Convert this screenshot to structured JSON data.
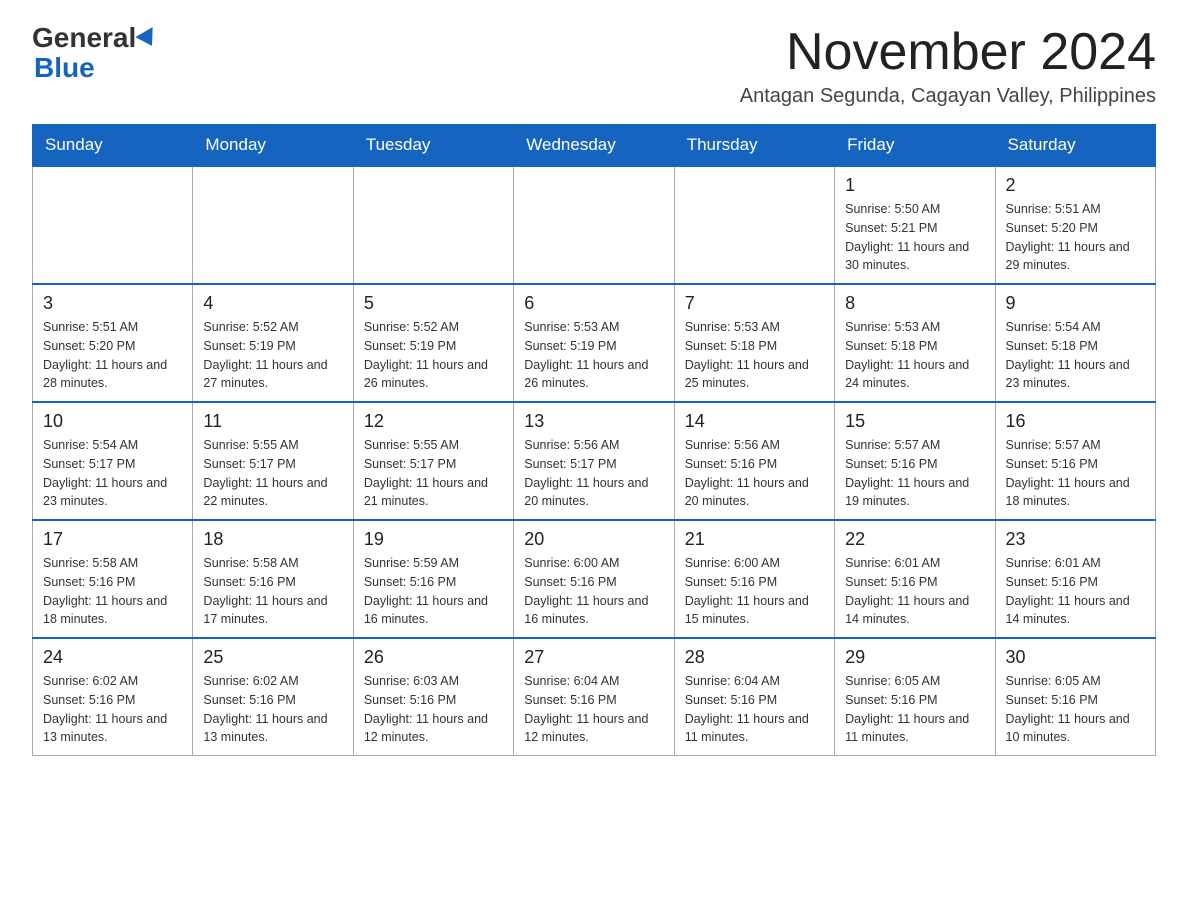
{
  "logo": {
    "general": "General",
    "blue": "Blue"
  },
  "title": "November 2024",
  "subtitle": "Antagan Segunda, Cagayan Valley, Philippines",
  "days_of_week": [
    "Sunday",
    "Monday",
    "Tuesday",
    "Wednesday",
    "Thursday",
    "Friday",
    "Saturday"
  ],
  "weeks": [
    [
      {
        "day": "",
        "info": ""
      },
      {
        "day": "",
        "info": ""
      },
      {
        "day": "",
        "info": ""
      },
      {
        "day": "",
        "info": ""
      },
      {
        "day": "",
        "info": ""
      },
      {
        "day": "1",
        "info": "Sunrise: 5:50 AM\nSunset: 5:21 PM\nDaylight: 11 hours and 30 minutes."
      },
      {
        "day": "2",
        "info": "Sunrise: 5:51 AM\nSunset: 5:20 PM\nDaylight: 11 hours and 29 minutes."
      }
    ],
    [
      {
        "day": "3",
        "info": "Sunrise: 5:51 AM\nSunset: 5:20 PM\nDaylight: 11 hours and 28 minutes."
      },
      {
        "day": "4",
        "info": "Sunrise: 5:52 AM\nSunset: 5:19 PM\nDaylight: 11 hours and 27 minutes."
      },
      {
        "day": "5",
        "info": "Sunrise: 5:52 AM\nSunset: 5:19 PM\nDaylight: 11 hours and 26 minutes."
      },
      {
        "day": "6",
        "info": "Sunrise: 5:53 AM\nSunset: 5:19 PM\nDaylight: 11 hours and 26 minutes."
      },
      {
        "day": "7",
        "info": "Sunrise: 5:53 AM\nSunset: 5:18 PM\nDaylight: 11 hours and 25 minutes."
      },
      {
        "day": "8",
        "info": "Sunrise: 5:53 AM\nSunset: 5:18 PM\nDaylight: 11 hours and 24 minutes."
      },
      {
        "day": "9",
        "info": "Sunrise: 5:54 AM\nSunset: 5:18 PM\nDaylight: 11 hours and 23 minutes."
      }
    ],
    [
      {
        "day": "10",
        "info": "Sunrise: 5:54 AM\nSunset: 5:17 PM\nDaylight: 11 hours and 23 minutes."
      },
      {
        "day": "11",
        "info": "Sunrise: 5:55 AM\nSunset: 5:17 PM\nDaylight: 11 hours and 22 minutes."
      },
      {
        "day": "12",
        "info": "Sunrise: 5:55 AM\nSunset: 5:17 PM\nDaylight: 11 hours and 21 minutes."
      },
      {
        "day": "13",
        "info": "Sunrise: 5:56 AM\nSunset: 5:17 PM\nDaylight: 11 hours and 20 minutes."
      },
      {
        "day": "14",
        "info": "Sunrise: 5:56 AM\nSunset: 5:16 PM\nDaylight: 11 hours and 20 minutes."
      },
      {
        "day": "15",
        "info": "Sunrise: 5:57 AM\nSunset: 5:16 PM\nDaylight: 11 hours and 19 minutes."
      },
      {
        "day": "16",
        "info": "Sunrise: 5:57 AM\nSunset: 5:16 PM\nDaylight: 11 hours and 18 minutes."
      }
    ],
    [
      {
        "day": "17",
        "info": "Sunrise: 5:58 AM\nSunset: 5:16 PM\nDaylight: 11 hours and 18 minutes."
      },
      {
        "day": "18",
        "info": "Sunrise: 5:58 AM\nSunset: 5:16 PM\nDaylight: 11 hours and 17 minutes."
      },
      {
        "day": "19",
        "info": "Sunrise: 5:59 AM\nSunset: 5:16 PM\nDaylight: 11 hours and 16 minutes."
      },
      {
        "day": "20",
        "info": "Sunrise: 6:00 AM\nSunset: 5:16 PM\nDaylight: 11 hours and 16 minutes."
      },
      {
        "day": "21",
        "info": "Sunrise: 6:00 AM\nSunset: 5:16 PM\nDaylight: 11 hours and 15 minutes."
      },
      {
        "day": "22",
        "info": "Sunrise: 6:01 AM\nSunset: 5:16 PM\nDaylight: 11 hours and 14 minutes."
      },
      {
        "day": "23",
        "info": "Sunrise: 6:01 AM\nSunset: 5:16 PM\nDaylight: 11 hours and 14 minutes."
      }
    ],
    [
      {
        "day": "24",
        "info": "Sunrise: 6:02 AM\nSunset: 5:16 PM\nDaylight: 11 hours and 13 minutes."
      },
      {
        "day": "25",
        "info": "Sunrise: 6:02 AM\nSunset: 5:16 PM\nDaylight: 11 hours and 13 minutes."
      },
      {
        "day": "26",
        "info": "Sunrise: 6:03 AM\nSunset: 5:16 PM\nDaylight: 11 hours and 12 minutes."
      },
      {
        "day": "27",
        "info": "Sunrise: 6:04 AM\nSunset: 5:16 PM\nDaylight: 11 hours and 12 minutes."
      },
      {
        "day": "28",
        "info": "Sunrise: 6:04 AM\nSunset: 5:16 PM\nDaylight: 11 hours and 11 minutes."
      },
      {
        "day": "29",
        "info": "Sunrise: 6:05 AM\nSunset: 5:16 PM\nDaylight: 11 hours and 11 minutes."
      },
      {
        "day": "30",
        "info": "Sunrise: 6:05 AM\nSunset: 5:16 PM\nDaylight: 11 hours and 10 minutes."
      }
    ]
  ]
}
